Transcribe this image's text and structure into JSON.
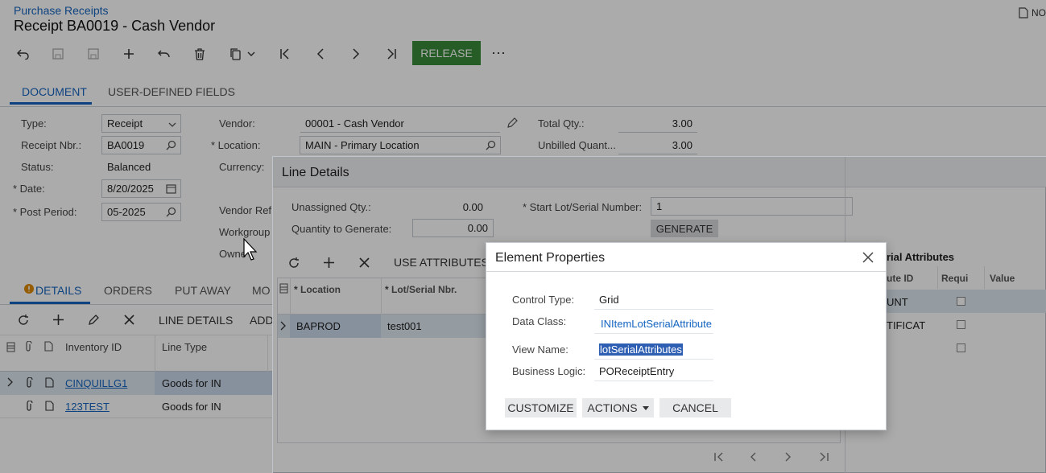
{
  "header": {
    "breadcrumb": "Purchase Receipts",
    "title": "Receipt BA0019 - Cash Vendor",
    "notes_label": "NO"
  },
  "toolbar": {
    "release_label": "RELEASE",
    "more_label": "⋯"
  },
  "tabs": [
    "DOCUMENT",
    "USER-DEFINED FIELDS"
  ],
  "form": {
    "type_label": "Type:",
    "type_value": "Receipt",
    "receipt_nbr_label": "Receipt Nbr.:",
    "receipt_nbr_value": "BA0019",
    "status_label": "Status:",
    "status_value": "Balanced",
    "date_label": "Date:",
    "date_value": "8/20/2025",
    "post_period_label": "Post Period:",
    "post_period_value": "05-2025",
    "vendor_label": "Vendor:",
    "vendor_value": "00001 - Cash Vendor",
    "location_label": "Location:",
    "location_value": "MAIN - Primary Location",
    "currency_label": "Currency:",
    "vendor_ref_label": "Vendor Ref",
    "workgroup_label": "Workgroup",
    "owner_label": "Owne",
    "total_qty_label": "Total Qty.:",
    "total_qty_value": "3.00",
    "unbilled_qty_label": "Unbilled Quant...",
    "unbilled_qty_value": "3.00"
  },
  "grid_tabs": [
    "DETAILS",
    "ORDERS",
    "PUT AWAY",
    "MO"
  ],
  "details_toolbar": {
    "line_details_label": "LINE DETAILS",
    "add_label": "ADD"
  },
  "details_grid": {
    "columns": [
      "Inventory ID",
      "Line Type"
    ],
    "rows": [
      {
        "inventory_id": "CINQUILLG1",
        "line_type": "Goods for IN"
      },
      {
        "inventory_id": "123TEST",
        "line_type": "Goods for IN"
      }
    ]
  },
  "line_details": {
    "title": "Line Details",
    "unassigned_qty_label": "Unassigned Qty.:",
    "unassigned_qty_value": "0.00",
    "qty_to_generate_label": "Quantity to Generate:",
    "qty_to_generate_value": "0.00",
    "start_lot_label": "Start Lot/Serial Number:",
    "start_lot_value": "1",
    "generate_label": "GENERATE",
    "use_attributes_label": "USE ATTRIBUTES",
    "columns": [
      "Location",
      "Lot/Serial Nbr."
    ],
    "rows": [
      {
        "location": "BAPROD",
        "lot_serial": "test001"
      }
    ],
    "attributes_title": "rial Attributes",
    "attr_columns": [
      "ute ID",
      "Requi",
      "Value"
    ],
    "attr_rows": [
      {
        "id": "UNT"
      },
      {
        "id": "TIFICAT"
      },
      {
        "id": ""
      }
    ]
  },
  "element_properties": {
    "title": "Element Properties",
    "control_type_label": "Control Type:",
    "control_type_value": "Grid",
    "data_class_label": "Data Class:",
    "data_class_value": "INItemLotSerialAttribute",
    "view_name_label": "View Name:",
    "view_name_value": "lotSerialAttributes",
    "business_logic_label": "Business Logic:",
    "business_logic_value": "POReceiptEntry",
    "customize_label": "CUSTOMIZE",
    "actions_label": "ACTIONS",
    "cancel_label": "CANCEL"
  },
  "colors": {
    "accent": "#1565c0",
    "release": "#3a8a3a",
    "selection": "#2f5fb3"
  }
}
